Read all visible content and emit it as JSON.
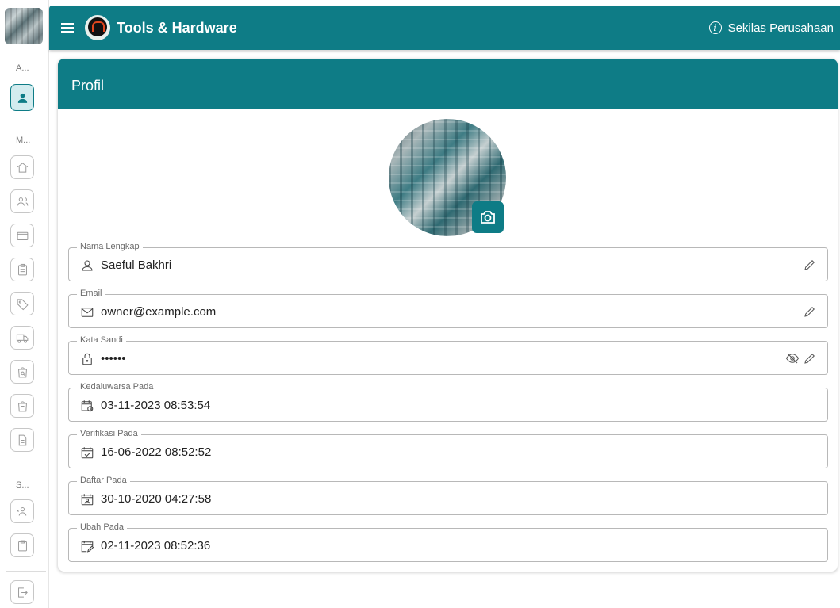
{
  "app": {
    "title": "Tools & Hardware",
    "company_link": "Sekilas Perusahaan"
  },
  "rail": {
    "section_account": "A...",
    "section_menu": "M...",
    "section_settings": "S..."
  },
  "profile": {
    "title": "Profil",
    "fields": [
      {
        "label": "Nama Lengkap",
        "value": "Saeful Bakhri"
      },
      {
        "label": "Email",
        "value": "owner@example.com"
      },
      {
        "label": "Kata Sandi",
        "value": "••••••"
      },
      {
        "label": "Kedaluwarsa Pada",
        "value": "03-11-2023 08:53:54"
      },
      {
        "label": "Verifikasi Pada",
        "value": "16-06-2022 08:52:52"
      },
      {
        "label": "Daftar Pada",
        "value": "30-10-2020 04:27:58"
      },
      {
        "label": "Ubah Pada",
        "value": "02-11-2023 08:52:36"
      }
    ]
  },
  "colors": {
    "primary": "#0e7c86"
  },
  "icons": [
    "menu-icon",
    "info-icon",
    "user-icon",
    "home-icon",
    "users-icon",
    "folder-icon",
    "clipboard-icon",
    "tag-icon",
    "truck-icon",
    "bag-search-icon",
    "bag-icon",
    "document-icon",
    "users-x-icon",
    "clipboard-copy-icon",
    "logout-icon",
    "camera-icon",
    "mail-icon",
    "lock-icon",
    "eye-off-icon",
    "pencil-icon",
    "calendar-clock-icon",
    "calendar-check-icon",
    "calendar-user-icon",
    "calendar-edit-icon"
  ]
}
